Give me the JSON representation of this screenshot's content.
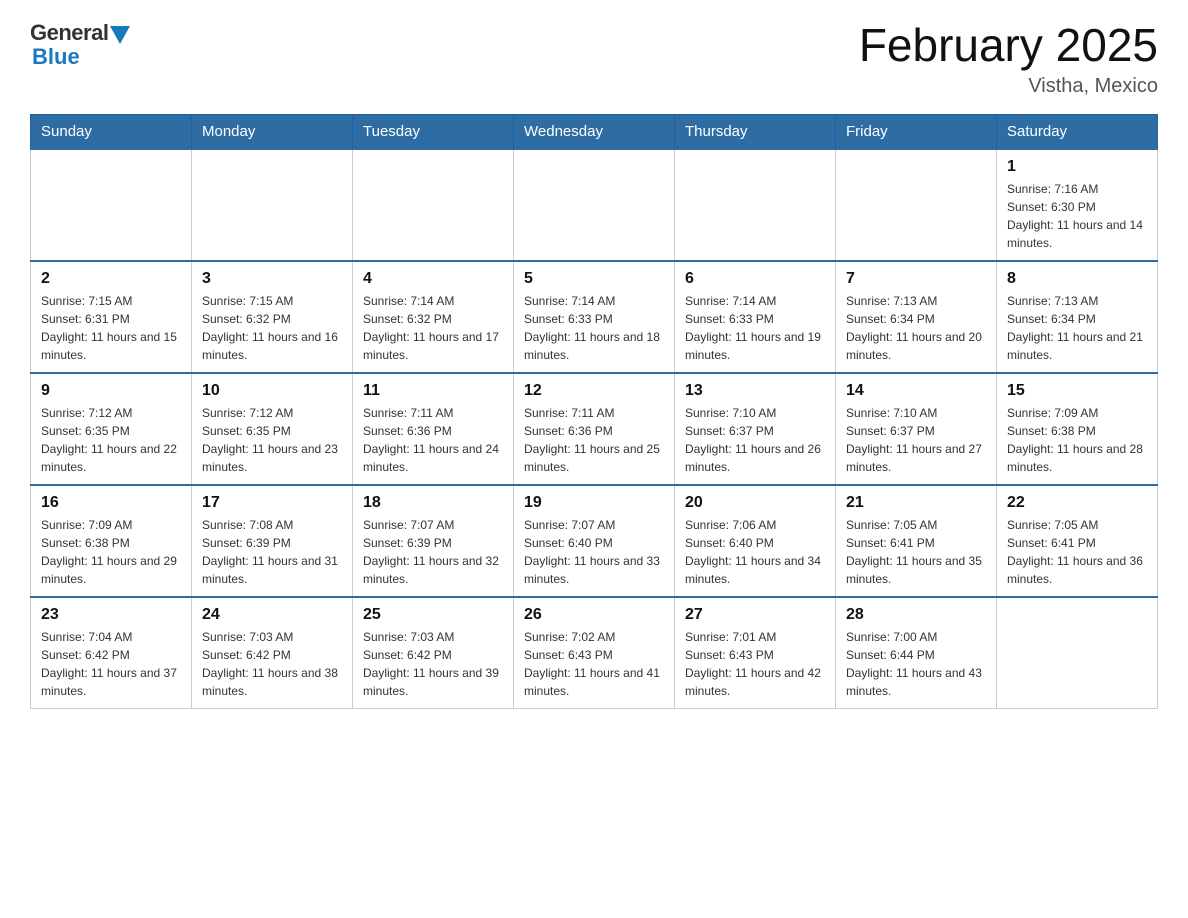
{
  "logo": {
    "general_text": "General",
    "blue_text": "Blue"
  },
  "header": {
    "month_title": "February 2025",
    "location": "Vistha, Mexico"
  },
  "days_of_week": [
    "Sunday",
    "Monday",
    "Tuesday",
    "Wednesday",
    "Thursday",
    "Friday",
    "Saturday"
  ],
  "weeks": [
    [
      {
        "day": "",
        "info": ""
      },
      {
        "day": "",
        "info": ""
      },
      {
        "day": "",
        "info": ""
      },
      {
        "day": "",
        "info": ""
      },
      {
        "day": "",
        "info": ""
      },
      {
        "day": "",
        "info": ""
      },
      {
        "day": "1",
        "info": "Sunrise: 7:16 AM\nSunset: 6:30 PM\nDaylight: 11 hours and 14 minutes."
      }
    ],
    [
      {
        "day": "2",
        "info": "Sunrise: 7:15 AM\nSunset: 6:31 PM\nDaylight: 11 hours and 15 minutes."
      },
      {
        "day": "3",
        "info": "Sunrise: 7:15 AM\nSunset: 6:32 PM\nDaylight: 11 hours and 16 minutes."
      },
      {
        "day": "4",
        "info": "Sunrise: 7:14 AM\nSunset: 6:32 PM\nDaylight: 11 hours and 17 minutes."
      },
      {
        "day": "5",
        "info": "Sunrise: 7:14 AM\nSunset: 6:33 PM\nDaylight: 11 hours and 18 minutes."
      },
      {
        "day": "6",
        "info": "Sunrise: 7:14 AM\nSunset: 6:33 PM\nDaylight: 11 hours and 19 minutes."
      },
      {
        "day": "7",
        "info": "Sunrise: 7:13 AM\nSunset: 6:34 PM\nDaylight: 11 hours and 20 minutes."
      },
      {
        "day": "8",
        "info": "Sunrise: 7:13 AM\nSunset: 6:34 PM\nDaylight: 11 hours and 21 minutes."
      }
    ],
    [
      {
        "day": "9",
        "info": "Sunrise: 7:12 AM\nSunset: 6:35 PM\nDaylight: 11 hours and 22 minutes."
      },
      {
        "day": "10",
        "info": "Sunrise: 7:12 AM\nSunset: 6:35 PM\nDaylight: 11 hours and 23 minutes."
      },
      {
        "day": "11",
        "info": "Sunrise: 7:11 AM\nSunset: 6:36 PM\nDaylight: 11 hours and 24 minutes."
      },
      {
        "day": "12",
        "info": "Sunrise: 7:11 AM\nSunset: 6:36 PM\nDaylight: 11 hours and 25 minutes."
      },
      {
        "day": "13",
        "info": "Sunrise: 7:10 AM\nSunset: 6:37 PM\nDaylight: 11 hours and 26 minutes."
      },
      {
        "day": "14",
        "info": "Sunrise: 7:10 AM\nSunset: 6:37 PM\nDaylight: 11 hours and 27 minutes."
      },
      {
        "day": "15",
        "info": "Sunrise: 7:09 AM\nSunset: 6:38 PM\nDaylight: 11 hours and 28 minutes."
      }
    ],
    [
      {
        "day": "16",
        "info": "Sunrise: 7:09 AM\nSunset: 6:38 PM\nDaylight: 11 hours and 29 minutes."
      },
      {
        "day": "17",
        "info": "Sunrise: 7:08 AM\nSunset: 6:39 PM\nDaylight: 11 hours and 31 minutes."
      },
      {
        "day": "18",
        "info": "Sunrise: 7:07 AM\nSunset: 6:39 PM\nDaylight: 11 hours and 32 minutes."
      },
      {
        "day": "19",
        "info": "Sunrise: 7:07 AM\nSunset: 6:40 PM\nDaylight: 11 hours and 33 minutes."
      },
      {
        "day": "20",
        "info": "Sunrise: 7:06 AM\nSunset: 6:40 PM\nDaylight: 11 hours and 34 minutes."
      },
      {
        "day": "21",
        "info": "Sunrise: 7:05 AM\nSunset: 6:41 PM\nDaylight: 11 hours and 35 minutes."
      },
      {
        "day": "22",
        "info": "Sunrise: 7:05 AM\nSunset: 6:41 PM\nDaylight: 11 hours and 36 minutes."
      }
    ],
    [
      {
        "day": "23",
        "info": "Sunrise: 7:04 AM\nSunset: 6:42 PM\nDaylight: 11 hours and 37 minutes."
      },
      {
        "day": "24",
        "info": "Sunrise: 7:03 AM\nSunset: 6:42 PM\nDaylight: 11 hours and 38 minutes."
      },
      {
        "day": "25",
        "info": "Sunrise: 7:03 AM\nSunset: 6:42 PM\nDaylight: 11 hours and 39 minutes."
      },
      {
        "day": "26",
        "info": "Sunrise: 7:02 AM\nSunset: 6:43 PM\nDaylight: 11 hours and 41 minutes."
      },
      {
        "day": "27",
        "info": "Sunrise: 7:01 AM\nSunset: 6:43 PM\nDaylight: 11 hours and 42 minutes."
      },
      {
        "day": "28",
        "info": "Sunrise: 7:00 AM\nSunset: 6:44 PM\nDaylight: 11 hours and 43 minutes."
      },
      {
        "day": "",
        "info": ""
      }
    ]
  ]
}
